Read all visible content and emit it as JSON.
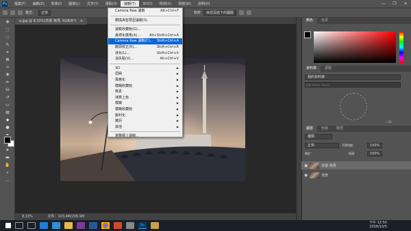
{
  "menubar": {
    "items": [
      "檔案(F)",
      "編輯(E)",
      "影像(I)",
      "圖層(L)",
      "文字(Y)",
      "選取(S)",
      "濾鏡(T)",
      "3D(D)",
      "檢視(V)",
      "視窗(W)",
      "說明(H)"
    ],
    "active": "濾鏡(T)"
  },
  "window_controls": [
    "—",
    "❐",
    "✕"
  ],
  "options": {
    "mode_label": "模式：",
    "mode_value": "正常",
    "opacity_label": "不透明",
    "sample_value": "目前及底下的圖層",
    "flow_label": "對齊"
  },
  "document": {
    "tab_title": "a.jpg @ 8.33%(背景 拷貝, RGB/8*)",
    "tab_close": "×"
  },
  "status": {
    "zoom": "8.33%",
    "file": "文件：103.4M/206.9M"
  },
  "filter_menu": {
    "items": [
      {
        "label": "Camera Raw 濾鏡",
        "shortcut": "Alt+Ctrl+F"
      },
      {
        "sep": true
      },
      {
        "label": "轉換為智慧型濾鏡(S)",
        "shortcut": ""
      },
      {
        "sep": true
      },
      {
        "label": "濾鏡收藏館(G)...",
        "shortcut": ""
      },
      {
        "label": "最適化廣角(A)...",
        "shortcut": "Alt+Shift+Ctrl+A"
      },
      {
        "label": "Camera Raw 濾鏡(C)...",
        "shortcut": "Shift+Ctrl+A",
        "highlight": true
      },
      {
        "label": "鏡頭校正(R)...",
        "shortcut": "Shift+Ctrl+R"
      },
      {
        "label": "液化(L)...",
        "shortcut": "Shift+Ctrl+X"
      },
      {
        "label": "消失點(V)...",
        "shortcut": "Alt+Ctrl+V"
      },
      {
        "sep": true
      },
      {
        "label": "3D",
        "shortcut": "",
        "sub": true
      },
      {
        "label": "扭曲",
        "shortcut": "",
        "sub": true
      },
      {
        "label": "風格化",
        "shortcut": "",
        "sub": true
      },
      {
        "label": "模糊收藏館",
        "shortcut": "",
        "sub": true
      },
      {
        "label": "像素",
        "shortcut": "",
        "sub": true
      },
      {
        "label": "演算上色",
        "shortcut": "",
        "sub": true
      },
      {
        "label": "模糊",
        "shortcut": "",
        "sub": true
      },
      {
        "label": "模糊收藏館",
        "shortcut": "",
        "sub": true
      },
      {
        "label": "銳利化",
        "shortcut": "",
        "sub": true
      },
      {
        "label": "雜訊",
        "shortcut": "",
        "sub": true
      },
      {
        "label": "其他",
        "shortcut": "",
        "sub": true
      },
      {
        "sep": true
      },
      {
        "label": "瀏覽網上濾鏡...",
        "shortcut": ""
      }
    ]
  },
  "panels": {
    "color_tabs": [
      "顏色",
      "色票"
    ],
    "libraries_tabs": [
      "資料庫",
      "調整"
    ],
    "library_select": "我的資料庫",
    "library_search_placeholder": "搜尋 Adobe Stock",
    "library_size": "— KB",
    "layers_tabs": [
      "圖層",
      "色版",
      "路徑"
    ],
    "kind_label": "種類",
    "blend_mode": "正常",
    "opacity_label": "不透明度：",
    "opacity_value": "100%",
    "lock_label": "鎖定：",
    "fill_label": "填滿：",
    "fill_value": "100%",
    "layers": [
      {
        "name": "背景 拷貝"
      },
      {
        "name": "背景"
      }
    ]
  },
  "taskbar": {
    "time": "下午 12:50",
    "date": "2018/10/5",
    "app_labels": [
      "Ps"
    ]
  },
  "colors": {
    "highlight": "#0a66d8",
    "menu_bg": "#f0f0f0",
    "ps_blue": "#31a8ff"
  }
}
